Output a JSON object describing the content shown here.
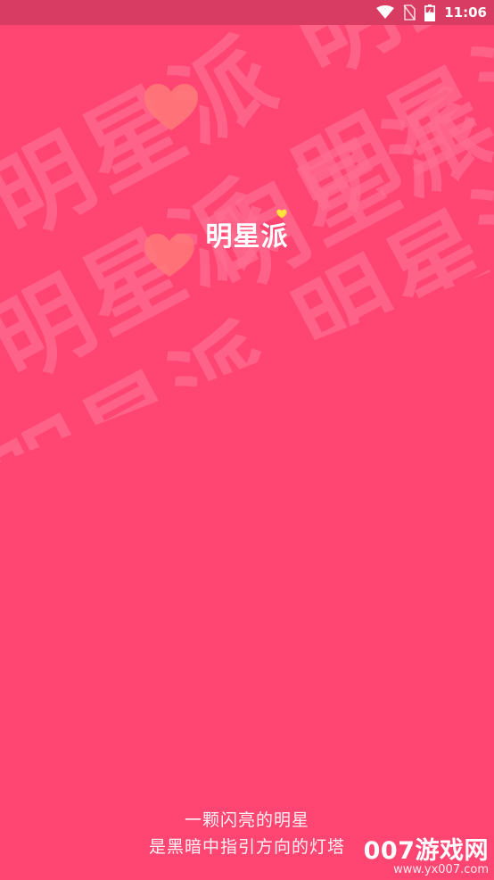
{
  "status_bar": {
    "time": "11:06",
    "icons": [
      "wifi-icon",
      "no-sim-icon",
      "battery-charging-icon"
    ]
  },
  "background": {
    "pattern_text": "明星派",
    "base_color": "#ff4673",
    "pattern_color": "#ff6e91"
  },
  "logo": {
    "text": "明星派",
    "accent_color": "#ffe23a"
  },
  "slogan": {
    "line1": "一颗闪亮的明星",
    "line2": "是黑暗中指引方向的灯塔"
  },
  "watermark": {
    "name": "007游戏网",
    "url": "www.yx007.com"
  }
}
